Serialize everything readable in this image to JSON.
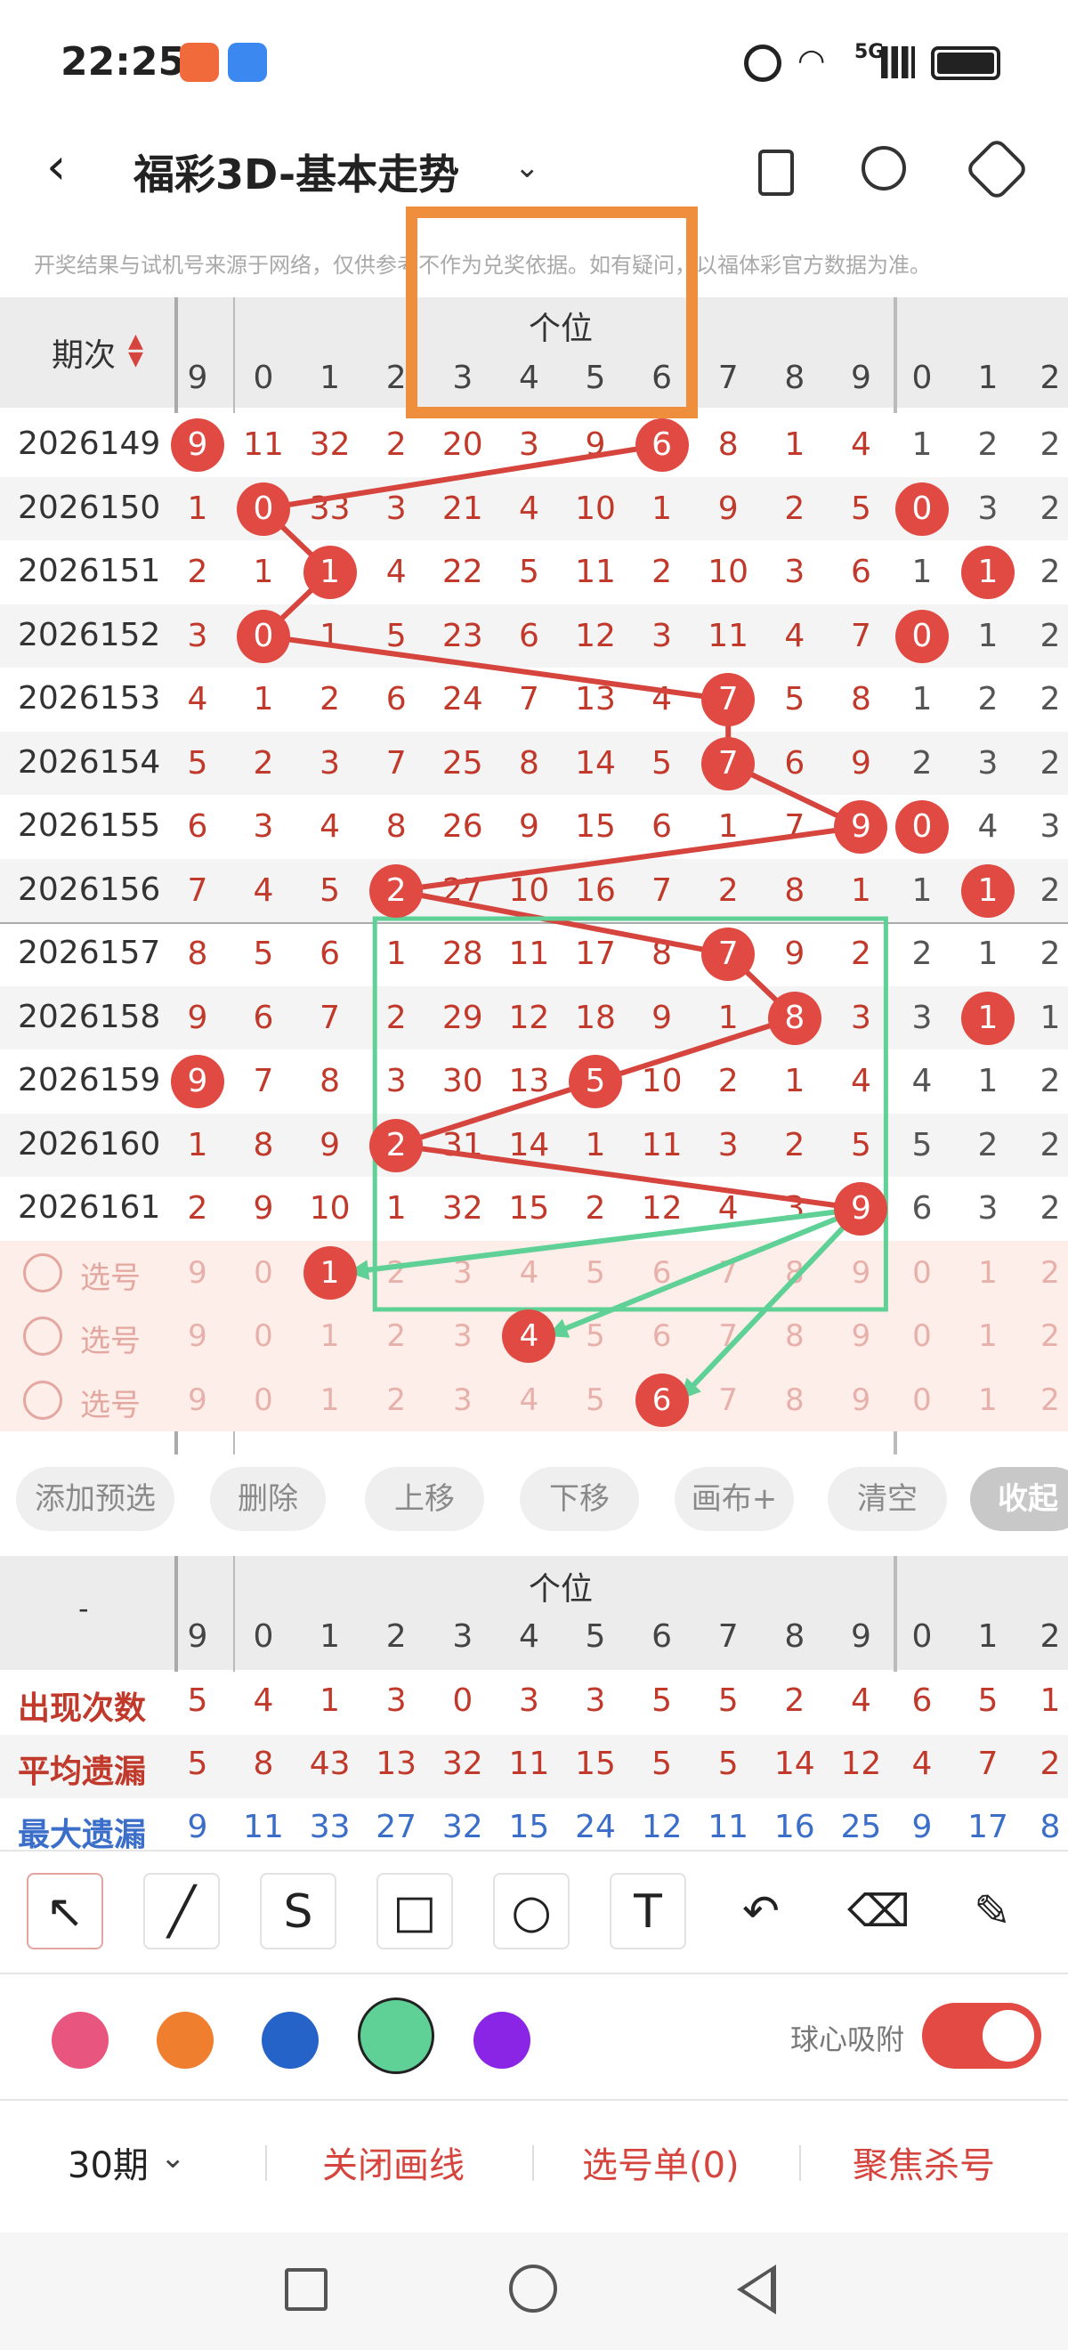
{
  "status": {
    "time": "22:25",
    "signal": "5G"
  },
  "header": {
    "title": "福彩3D-基本走势",
    "notice": "开奖结果与试机号来源于网络，仅供参考不作为兑奖依据。如有疑问，以福体彩官方数据为准。"
  },
  "table": {
    "period_label": "期次",
    "group_label": "个位",
    "first_col_header": "9",
    "digit_headers": [
      "0",
      "1",
      "2",
      "3",
      "4",
      "5",
      "6",
      "7",
      "8",
      "9"
    ],
    "right_headers": [
      "0",
      "1",
      "2"
    ],
    "rows": [
      {
        "issue": "2026149",
        "c0": "9",
        "d": [
          "11",
          "32",
          "2",
          "20",
          "3",
          "9",
          "6",
          "8",
          "1",
          "4"
        ],
        "r": [
          "1",
          "2",
          "2"
        ],
        "hit": 6
      },
      {
        "issue": "2026150",
        "c0": "1",
        "d": [
          "0",
          "33",
          "3",
          "21",
          "4",
          "10",
          "1",
          "9",
          "2",
          "5"
        ],
        "r": [
          "0",
          "3",
          "2"
        ],
        "hit": 0
      },
      {
        "issue": "2026151",
        "c0": "2",
        "d": [
          "1",
          "1",
          "4",
          "22",
          "5",
          "11",
          "2",
          "10",
          "3",
          "6"
        ],
        "r": [
          "1",
          "1",
          "2"
        ],
        "hit": 1
      },
      {
        "issue": "2026152",
        "c0": "3",
        "d": [
          "0",
          "1",
          "5",
          "23",
          "6",
          "12",
          "3",
          "11",
          "4",
          "7"
        ],
        "r": [
          "0",
          "1",
          "2"
        ],
        "hit": 0
      },
      {
        "issue": "2026153",
        "c0": "4",
        "d": [
          "1",
          "2",
          "6",
          "24",
          "7",
          "13",
          "4",
          "7",
          "5",
          "8"
        ],
        "r": [
          "1",
          "2",
          "2"
        ],
        "hit": 7
      },
      {
        "issue": "2026154",
        "c0": "5",
        "d": [
          "2",
          "3",
          "7",
          "25",
          "8",
          "14",
          "5",
          "7",
          "6",
          "9"
        ],
        "r": [
          "2",
          "3",
          "2"
        ],
        "hit": 7
      },
      {
        "issue": "2026155",
        "c0": "6",
        "d": [
          "3",
          "4",
          "8",
          "26",
          "9",
          "15",
          "6",
          "1",
          "7",
          "9"
        ],
        "r": [
          "0",
          "4",
          "3"
        ],
        "hit": 9
      },
      {
        "issue": "2026156",
        "c0": "7",
        "d": [
          "4",
          "5",
          "2",
          "27",
          "10",
          "16",
          "7",
          "2",
          "8",
          "1"
        ],
        "r": [
          "1",
          "1",
          "2"
        ],
        "hit": 2
      },
      {
        "issue": "2026157",
        "c0": "8",
        "d": [
          "5",
          "6",
          "1",
          "28",
          "11",
          "17",
          "8",
          "7",
          "9",
          "2"
        ],
        "r": [
          "2",
          "1",
          "2"
        ],
        "hit": 7
      },
      {
        "issue": "2026158",
        "c0": "9",
        "d": [
          "6",
          "7",
          "2",
          "29",
          "12",
          "18",
          "9",
          "1",
          "8",
          "3"
        ],
        "r": [
          "3",
          "1",
          "1"
        ],
        "hit": 8
      },
      {
        "issue": "2026159",
        "c0": "9",
        "d": [
          "7",
          "8",
          "3",
          "30",
          "13",
          "5",
          "10",
          "2",
          "1",
          "4"
        ],
        "r": [
          "4",
          "1",
          "2"
        ],
        "hit": 5
      },
      {
        "issue": "2026160",
        "c0": "1",
        "d": [
          "8",
          "9",
          "2",
          "31",
          "14",
          "1",
          "11",
          "3",
          "2",
          "5"
        ],
        "r": [
          "5",
          "2",
          "2"
        ],
        "hit": 2
      },
      {
        "issue": "2026161",
        "c0": "2",
        "d": [
          "9",
          "10",
          "1",
          "32",
          "15",
          "2",
          "12",
          "4",
          "3",
          "9"
        ],
        "r": [
          "6",
          "3",
          "2"
        ],
        "hit": 9
      }
    ],
    "select_label": "选号",
    "select_rows": [
      {
        "c0": "9",
        "d": [
          "0",
          "1",
          "2",
          "3",
          "4",
          "5",
          "6",
          "7",
          "8",
          "9"
        ],
        "r": [
          "0",
          "1",
          "2"
        ]
      },
      {
        "c0": "9",
        "d": [
          "0",
          "1",
          "2",
          "3",
          "4",
          "5",
          "6",
          "7",
          "8",
          "9"
        ],
        "r": [
          "0",
          "1",
          "2"
        ]
      },
      {
        "c0": "9",
        "d": [
          "0",
          "1",
          "2",
          "3",
          "4",
          "5",
          "6",
          "7",
          "8",
          "9"
        ],
        "r": [
          "0",
          "1",
          "2"
        ]
      }
    ]
  },
  "controls": {
    "add": "添加预选",
    "delete": "删除",
    "up": "上移",
    "down": "下移",
    "canvas": "画布+",
    "clear": "清空",
    "collapse": "收起"
  },
  "stats": {
    "dash": "-",
    "group_label": "个位",
    "rows": [
      {
        "label": "出现次数",
        "c0": "5",
        "d": [
          "4",
          "1",
          "3",
          "0",
          "3",
          "3",
          "5",
          "5",
          "2",
          "4"
        ],
        "r": [
          "6",
          "5",
          "1"
        ]
      },
      {
        "label": "平均遗漏",
        "c0": "5",
        "d": [
          "8",
          "43",
          "13",
          "32",
          "11",
          "15",
          "5",
          "5",
          "14",
          "12"
        ],
        "r": [
          "4",
          "7",
          "2"
        ]
      },
      {
        "label": "最大遗漏",
        "c0": "9",
        "d": [
          "11",
          "33",
          "27",
          "32",
          "15",
          "24",
          "12",
          "11",
          "16",
          "25"
        ],
        "r": [
          "9",
          "17",
          "8"
        ]
      }
    ]
  },
  "tools": [
    "select-arrow-icon",
    "line-icon",
    "freehand-icon",
    "rectangle-icon",
    "circle-icon",
    "text-icon",
    "undo-icon",
    "eraser-icon",
    "brush-icon"
  ],
  "colors": {
    "pink": "#e8567f",
    "orange": "#ef7e2e",
    "blue": "#2563c9",
    "green": "#5fd197",
    "purple": "#8b25e6",
    "ball": "#e04a43",
    "line": "#d6443e",
    "arrow": "#5fd197"
  },
  "snap_label": "球心吸附",
  "bottom": {
    "periods": "30期",
    "close_line": "关闭画线",
    "select_list": "选号单(0)",
    "focus": "聚焦杀号"
  }
}
